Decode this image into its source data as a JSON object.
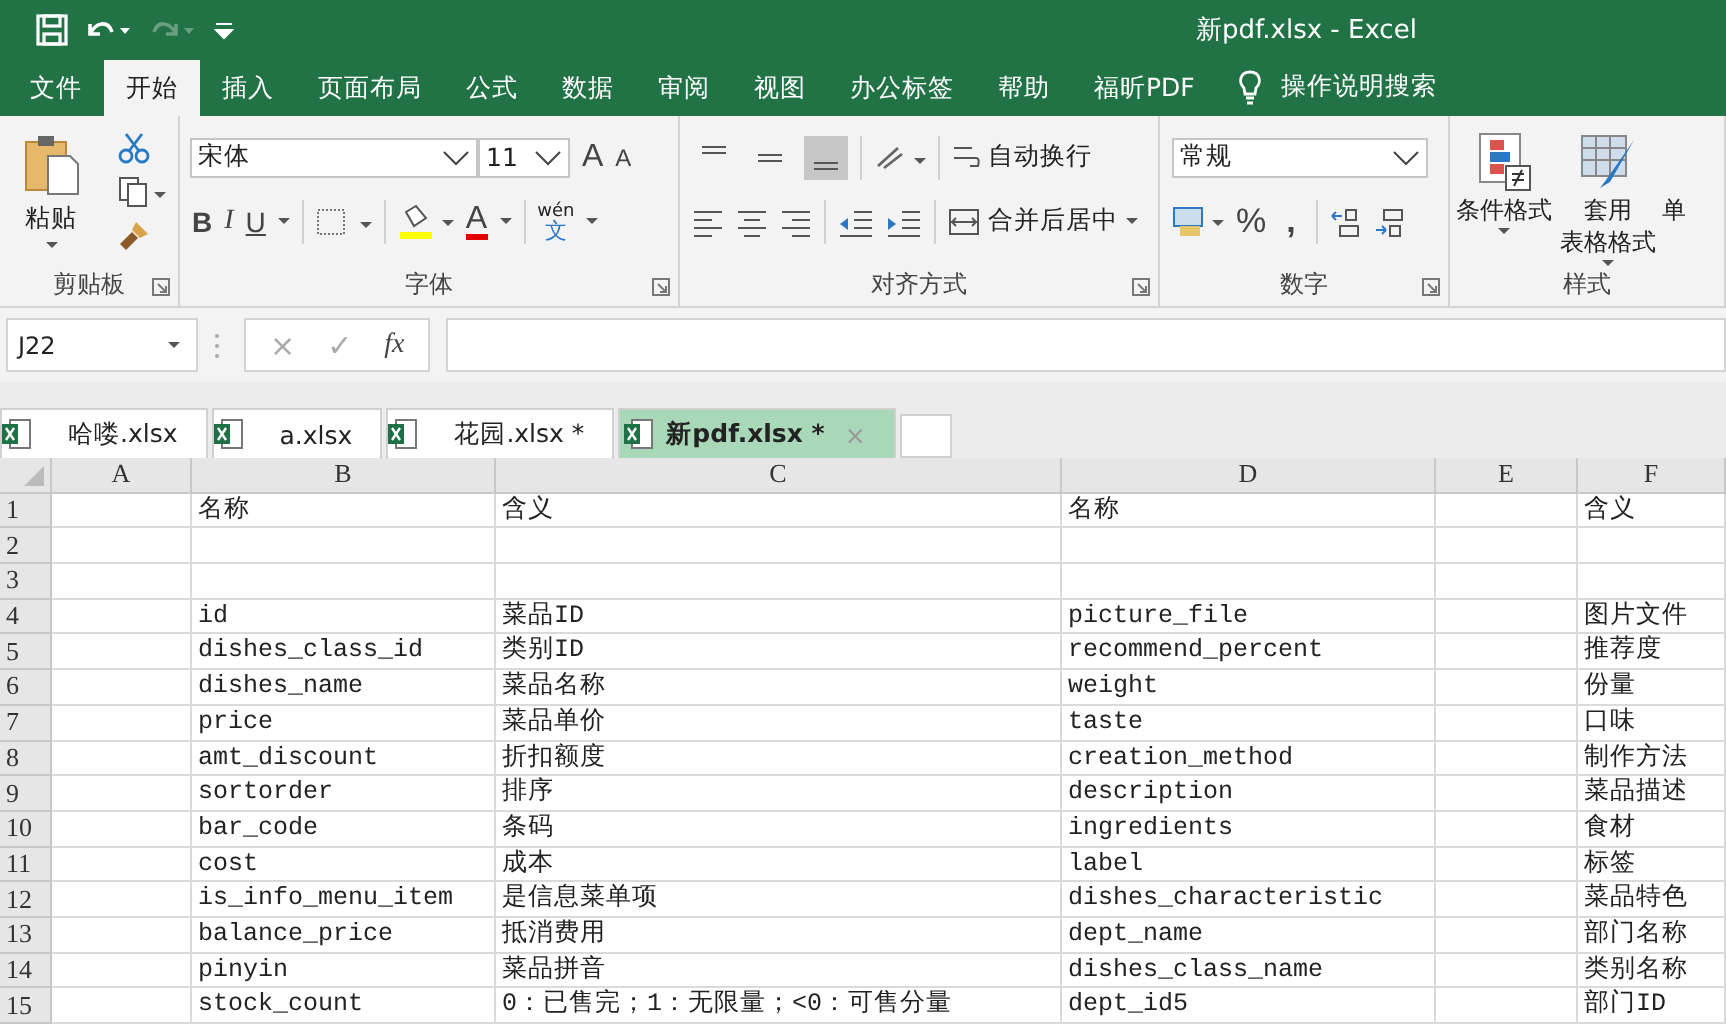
{
  "window": {
    "title": "新pdf.xlsx  -  Excel"
  },
  "ribbon_tabs": [
    {
      "label": "文件",
      "selected": false
    },
    {
      "label": "开始",
      "selected": true
    },
    {
      "label": "插入",
      "selected": false
    },
    {
      "label": "页面布局",
      "selected": false
    },
    {
      "label": "公式",
      "selected": false
    },
    {
      "label": "数据",
      "selected": false
    },
    {
      "label": "审阅",
      "selected": false
    },
    {
      "label": "视图",
      "selected": false
    },
    {
      "label": "办公标签",
      "selected": false
    },
    {
      "label": "帮助",
      "selected": false
    },
    {
      "label": "福昕PDF",
      "selected": false
    }
  ],
  "tell_me": "操作说明搜索",
  "clipboard": {
    "paste": "粘贴",
    "label": "剪贴板"
  },
  "font": {
    "name": "宋体",
    "size": "11",
    "grow": "A",
    "shrink": "A",
    "styles": [
      "B",
      "I",
      "U"
    ],
    "fill_letter": "A",
    "phonetic_top": "wén",
    "phonetic_bottom": "文",
    "label": "字体"
  },
  "alignment": {
    "vertical": [
      {
        "selected": false
      },
      {
        "selected": false
      },
      {
        "selected": true
      }
    ],
    "wrap_text": "自动换行",
    "merge": "合并后居中",
    "label": "对齐方式"
  },
  "number": {
    "format": "常规",
    "percent": "%",
    "comma": ",",
    "label": "数字"
  },
  "styles": {
    "conditional": "条件格式",
    "table_top": "套用",
    "table_bottom": "表格格式",
    "cut_button": "单",
    "label": "样式"
  },
  "formula_bar": {
    "name_box": "J22",
    "cancel": "×",
    "enter": "✓",
    "function": "fx"
  },
  "file_tabs": [
    {
      "label": "哈喽.xlsx",
      "selected": false
    },
    {
      "label": "a.xlsx",
      "selected": false
    },
    {
      "label": "花园.xlsx *",
      "selected": false
    },
    {
      "label": "新pdf.xlsx *",
      "selected": true,
      "close": "×"
    }
  ],
  "sheet": {
    "columns": [
      "A",
      "B",
      "C",
      "D",
      "E",
      "F"
    ],
    "rows": [
      {
        "number": "1",
        "cells": [
          "",
          "名称",
          "含义",
          "名称",
          "",
          "含义"
        ]
      },
      {
        "number": "2",
        "cells": [
          "",
          "",
          "",
          "",
          "",
          ""
        ]
      },
      {
        "number": "3",
        "cells": [
          "",
          "",
          "",
          "",
          "",
          ""
        ]
      },
      {
        "number": "4",
        "cells": [
          "",
          "id",
          "菜品ID",
          "picture_file",
          "",
          "图片文件"
        ]
      },
      {
        "number": "5",
        "cells": [
          "",
          "dishes_class_id",
          "类别ID",
          "recommend_percent",
          "",
          "推荐度"
        ]
      },
      {
        "number": "6",
        "cells": [
          "",
          "dishes_name",
          "菜品名称",
          "weight",
          "",
          "份量"
        ]
      },
      {
        "number": "7",
        "cells": [
          "",
          "price",
          "菜品单价",
          "taste",
          "",
          "口味"
        ]
      },
      {
        "number": "8",
        "cells": [
          "",
          "amt_discount",
          "折扣额度",
          "creation_method",
          "",
          "制作方法"
        ]
      },
      {
        "number": "9",
        "cells": [
          "",
          "sortorder",
          "排序",
          "description",
          "",
          "菜品描述"
        ]
      },
      {
        "number": "10",
        "cells": [
          "",
          "bar_code",
          "条码",
          "ingredients",
          "",
          "食材"
        ]
      },
      {
        "number": "11",
        "cells": [
          "",
          "cost",
          "成本",
          "label",
          "",
          "标签"
        ]
      },
      {
        "number": "12",
        "cells": [
          "",
          "is_info_menu_item",
          "是信息菜单项",
          "dishes_characteristic",
          "",
          "菜品特色"
        ]
      },
      {
        "number": "13",
        "cells": [
          "",
          "balance_price",
          "抵消费用",
          "dept_name",
          "",
          "部门名称"
        ]
      },
      {
        "number": "14",
        "cells": [
          "",
          "pinyin",
          "菜品拼音",
          "dishes_class_name",
          "",
          "类别名称"
        ]
      },
      {
        "number": "15",
        "cells": [
          "",
          "stock_count",
          "0：已售完；1：无限量；<0：可售分量",
          "dept_id5",
          "",
          "部门ID"
        ]
      }
    ]
  }
}
